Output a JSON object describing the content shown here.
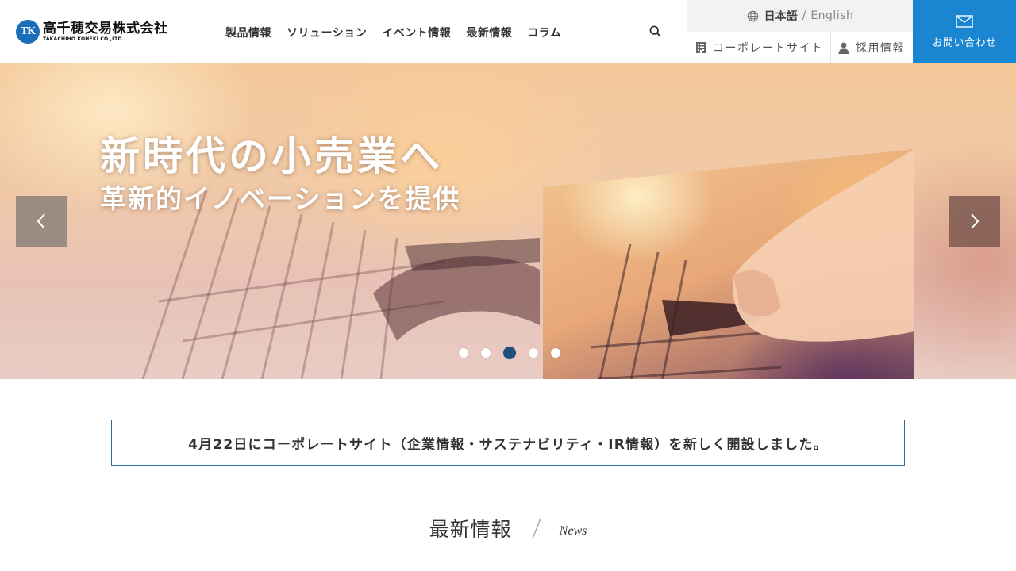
{
  "header": {
    "logo": {
      "mark": "TK",
      "name_jp": "高千穂交易株式会社",
      "name_en": "TAKACHIHO KOHEKI CO.,LTD."
    },
    "nav": [
      {
        "label": "製品情報"
      },
      {
        "label": "ソリューション"
      },
      {
        "label": "イベント情報"
      },
      {
        "label": "最新情報"
      },
      {
        "label": "コラム"
      }
    ],
    "search_icon": "search-icon",
    "language": {
      "current": "日本語",
      "separator": "/",
      "other": "English",
      "icon": "globe-icon"
    },
    "corporate_site": {
      "label": "コーポレートサイト",
      "icon": "building-icon"
    },
    "recruit": {
      "label": "採用情報",
      "icon": "person-icon"
    },
    "contact": {
      "label": "お問い合わせ",
      "icon": "mail-icon"
    }
  },
  "hero": {
    "headline": "新時代の小売業へ",
    "subheadline": "革新的イノベーションを提供",
    "slides_total": 5,
    "active_slide": 3,
    "colors": {
      "prev_arrow": "#827873",
      "next_arrow": "#7d5850",
      "active_dot": "#1e4f7d"
    }
  },
  "notice": {
    "text": "4月22日にコーポレートサイト（企業情報・サステナビリティ・IR情報）を新しく開設しました。"
  },
  "news_section": {
    "title_jp": "最新情報",
    "title_en": "News"
  },
  "colors": {
    "brand_blue": "#1a86d1",
    "notice_border": "#2e6da4"
  }
}
